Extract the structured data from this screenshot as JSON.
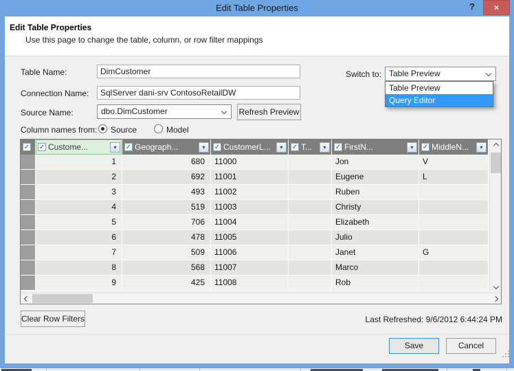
{
  "titlebar": {
    "title": "Edit Table Properties"
  },
  "icons": {
    "help": "?",
    "close": "×",
    "check": "✓",
    "filter_arrow": "▾"
  },
  "header": {
    "title": "Edit Table Properties",
    "subtitle": "Use this page to change the table, column, or row filter mappings"
  },
  "form": {
    "table_name_label": "Table Name:",
    "table_name_value": "DimCustomer",
    "connection_name_label": "Connection Name:",
    "connection_name_value": "SqlServer dani-srv ContosoRetailDW",
    "source_name_label": "Source Name:",
    "source_name_value": "dbo.DimCustomer",
    "refresh_preview_label": "Refresh Preview",
    "column_names_label": "Column names from:",
    "radio_source_label": "Source",
    "radio_model_label": "Model",
    "radio_selected": "Source",
    "switch_to_label": "Switch to:",
    "switch_to_value": "Table Preview",
    "dropdown_options": [
      "Table Preview",
      "Query Editor"
    ],
    "dropdown_highlighted": "Query Editor"
  },
  "grid": {
    "select_all_checked": true,
    "columns": [
      {
        "label": "Custome...",
        "checked": true,
        "selected": true
      },
      {
        "label": "Geograph...",
        "checked": true,
        "selected": false
      },
      {
        "label": "CustomerL...",
        "checked": true,
        "selected": false
      },
      {
        "label": "T...",
        "checked": true,
        "selected": false
      },
      {
        "label": "FirstN...",
        "checked": true,
        "selected": false
      },
      {
        "label": "MiddleN...",
        "checked": true,
        "selected": false
      }
    ],
    "rows": [
      [
        "1",
        "680",
        "11000",
        "",
        "Jon",
        "V"
      ],
      [
        "2",
        "692",
        "11001",
        "",
        "Eugene",
        "L"
      ],
      [
        "3",
        "493",
        "11002",
        "",
        "Ruben",
        ""
      ],
      [
        "4",
        "519",
        "11003",
        "",
        "Christy",
        ""
      ],
      [
        "5",
        "706",
        "11004",
        "",
        "Elizabeth",
        ""
      ],
      [
        "6",
        "478",
        "11005",
        "",
        "Julio",
        ""
      ],
      [
        "7",
        "509",
        "11006",
        "",
        "Janet",
        "G"
      ],
      [
        "8",
        "568",
        "11007",
        "",
        "Marco",
        ""
      ],
      [
        "9",
        "425",
        "11008",
        "",
        "Rob",
        ""
      ]
    ]
  },
  "footer": {
    "clear_row_filters_label": "Clear Row Filters",
    "last_refreshed": "Last Refreshed: 9/6/2012 6:44:24 PM",
    "save_label": "Save",
    "cancel_label": "Cancel"
  },
  "colors": {
    "frame": "#6fa5e2",
    "close_button": "#c95a5a",
    "selection_highlight": "#3399ff",
    "selected_column_header": "#dff0df",
    "grid_header": "#7e7e7e",
    "save_focus_border": "#3c8ddc"
  }
}
